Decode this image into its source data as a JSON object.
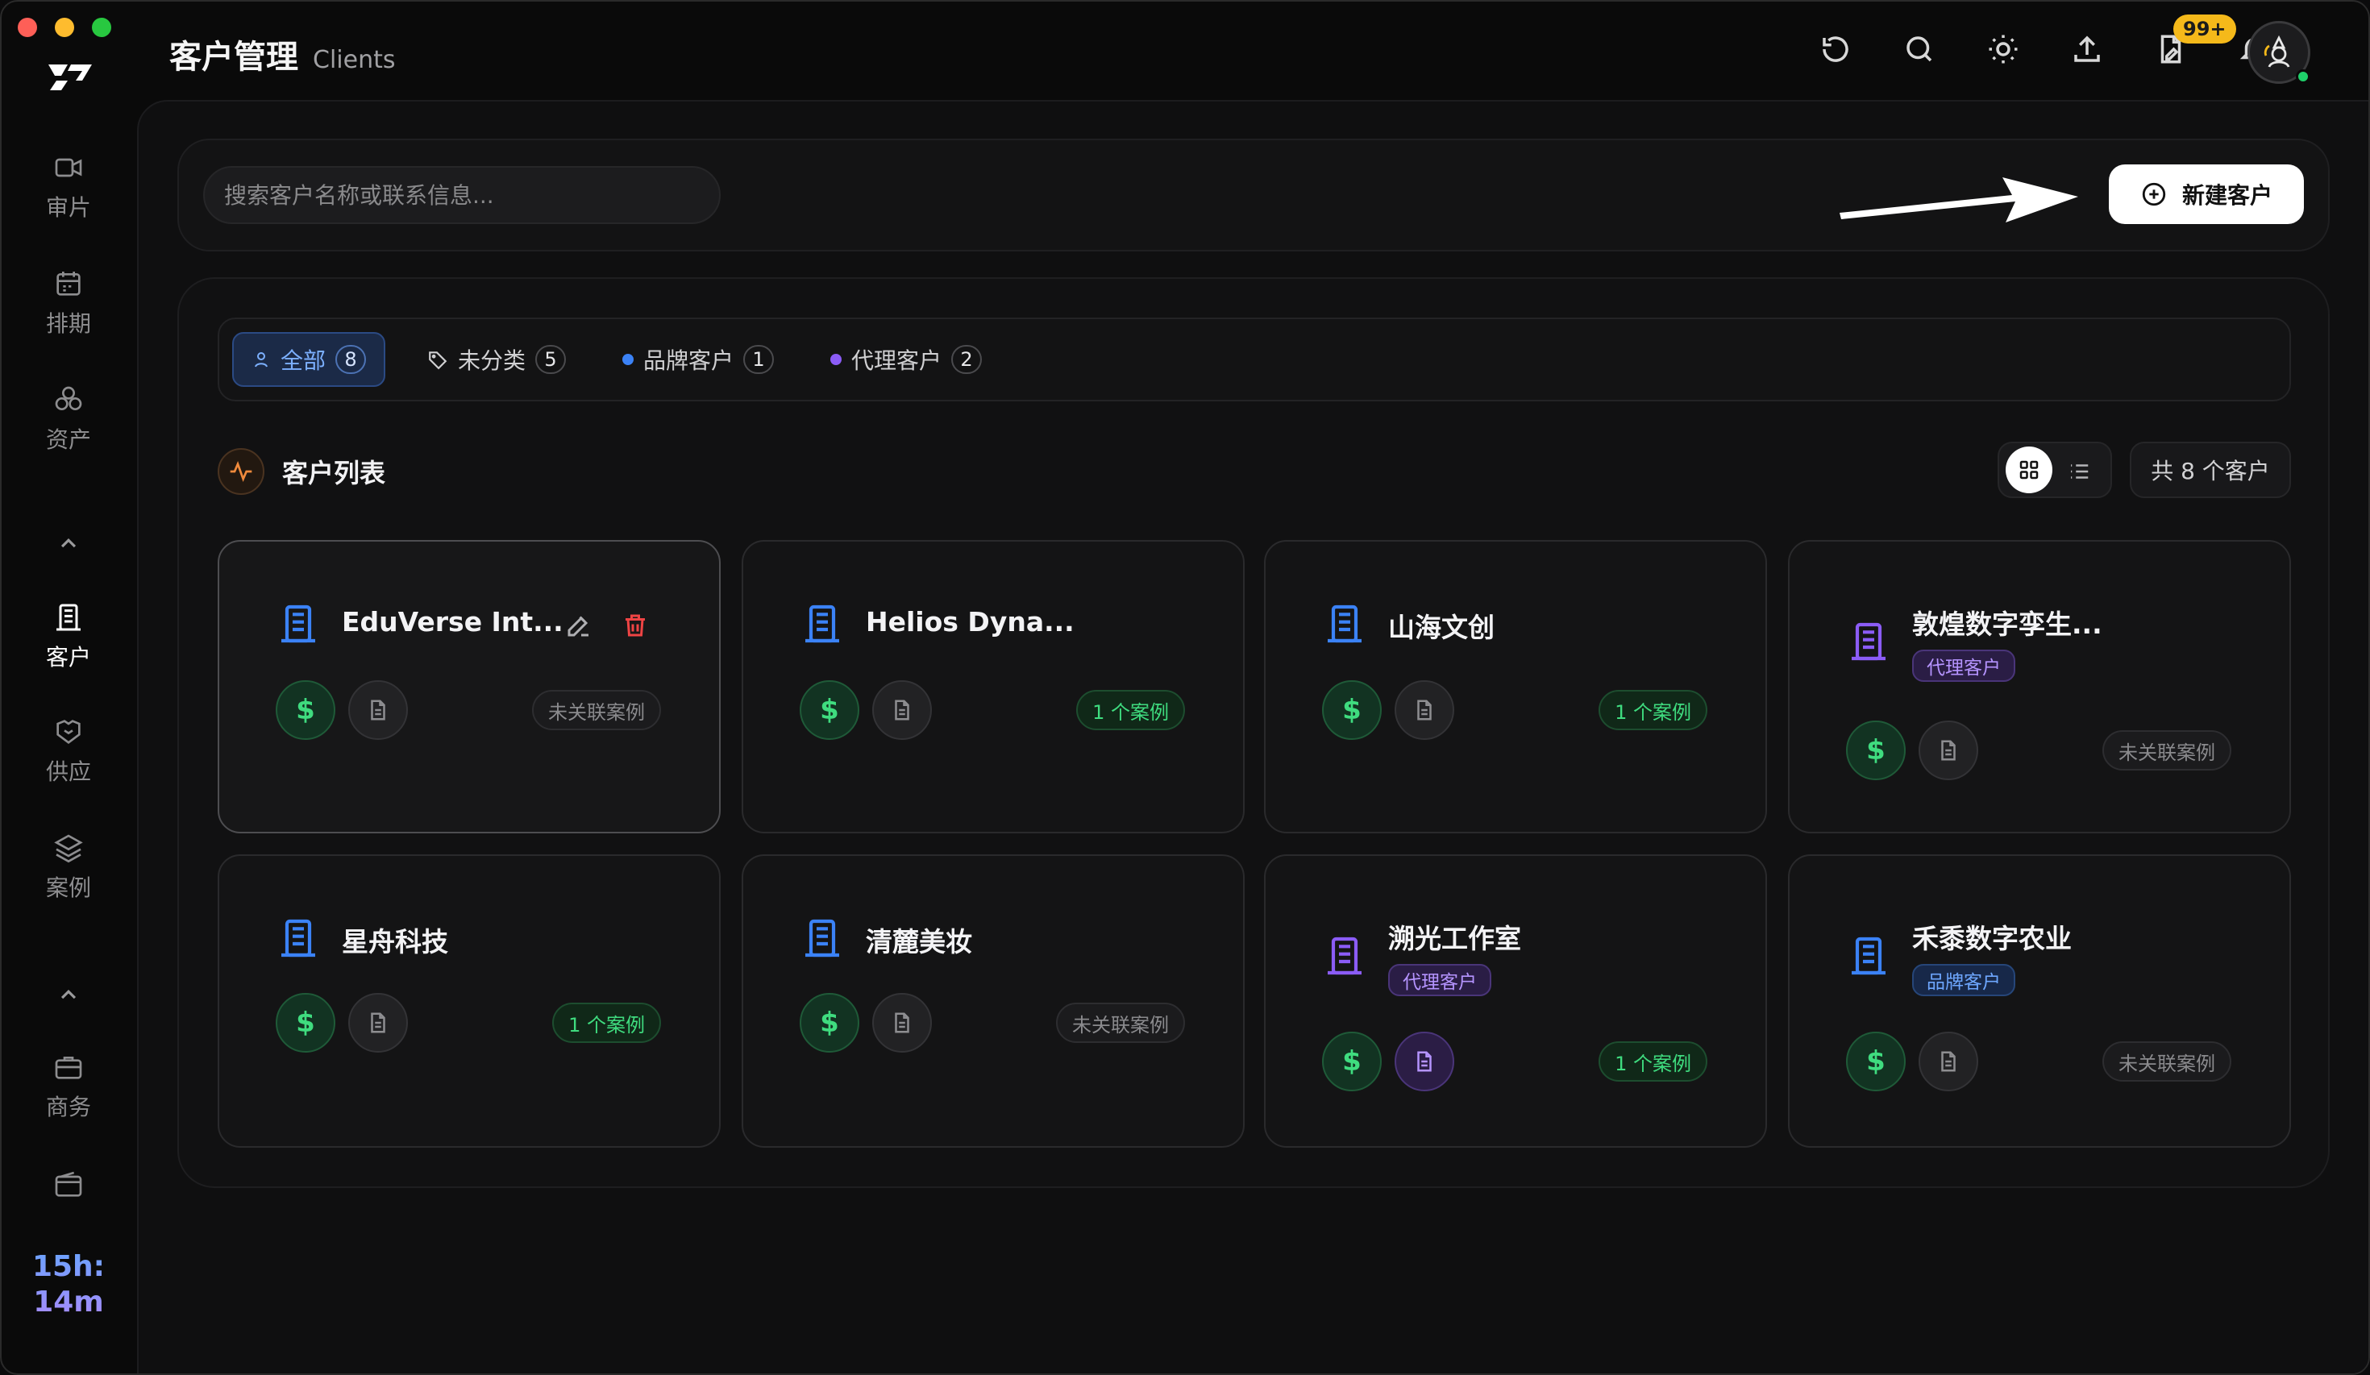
{
  "app": {
    "title_zh": "客户管理",
    "title_en": "Clients"
  },
  "sidebar": {
    "items": [
      {
        "label": "审片",
        "icon": "video-icon"
      },
      {
        "label": "排期",
        "icon": "calendar-icon"
      },
      {
        "label": "资产",
        "icon": "assets-icon"
      },
      {
        "label": "客户",
        "icon": "building-icon"
      },
      {
        "label": "供应",
        "icon": "handshake-icon"
      },
      {
        "label": "案例",
        "icon": "layers-icon"
      },
      {
        "label": "商务",
        "icon": "briefcase-icon"
      }
    ],
    "timer": "15h:\n14m"
  },
  "topbar": {
    "icons": [
      "refresh-icon",
      "search-icon",
      "sun-icon",
      "upload-icon",
      "file-sign-icon",
      "bell-icon"
    ],
    "notification_badge": "99+"
  },
  "search": {
    "placeholder": "搜索客户名称或联系信息..."
  },
  "new_client_button": "新建客户",
  "filters": [
    {
      "label": "全部",
      "count": "8",
      "active": true
    },
    {
      "label": "未分类",
      "count": "5"
    },
    {
      "label": "品牌客户",
      "count": "1",
      "dot_color": "#3b82f6"
    },
    {
      "label": "代理客户",
      "count": "2",
      "dot_color": "#8b5cf6"
    }
  ],
  "section": {
    "title": "客户列表",
    "total": "共 8 个客户"
  },
  "clients": [
    {
      "name": "EduVerse Int...",
      "tag": "",
      "status": "未关联案例"
    },
    {
      "name": "Helios Dyna...",
      "tag": "",
      "status": "1 个案例"
    },
    {
      "name": "山海文创",
      "tag": "",
      "status": "1 个案例"
    },
    {
      "name": "敦煌数字孪生...",
      "tag": "代理客户",
      "status": "未关联案例"
    },
    {
      "name": "星舟科技",
      "tag": "",
      "status": "1 个案例"
    },
    {
      "name": "清麓美妆",
      "tag": "",
      "status": "未关联案例"
    },
    {
      "name": "溯光工作室",
      "tag": "代理客户",
      "status": "1 个案例"
    },
    {
      "name": "禾黍数字农业",
      "tag": "品牌客户",
      "status": "未关联案例"
    }
  ],
  "colors": {
    "brand_blue": "#3b82f6",
    "agent_purple": "#8b5cf6",
    "success_green": "#3fdc7f",
    "danger_red": "#ef4444",
    "badge_yellow": "#f5b91a"
  }
}
